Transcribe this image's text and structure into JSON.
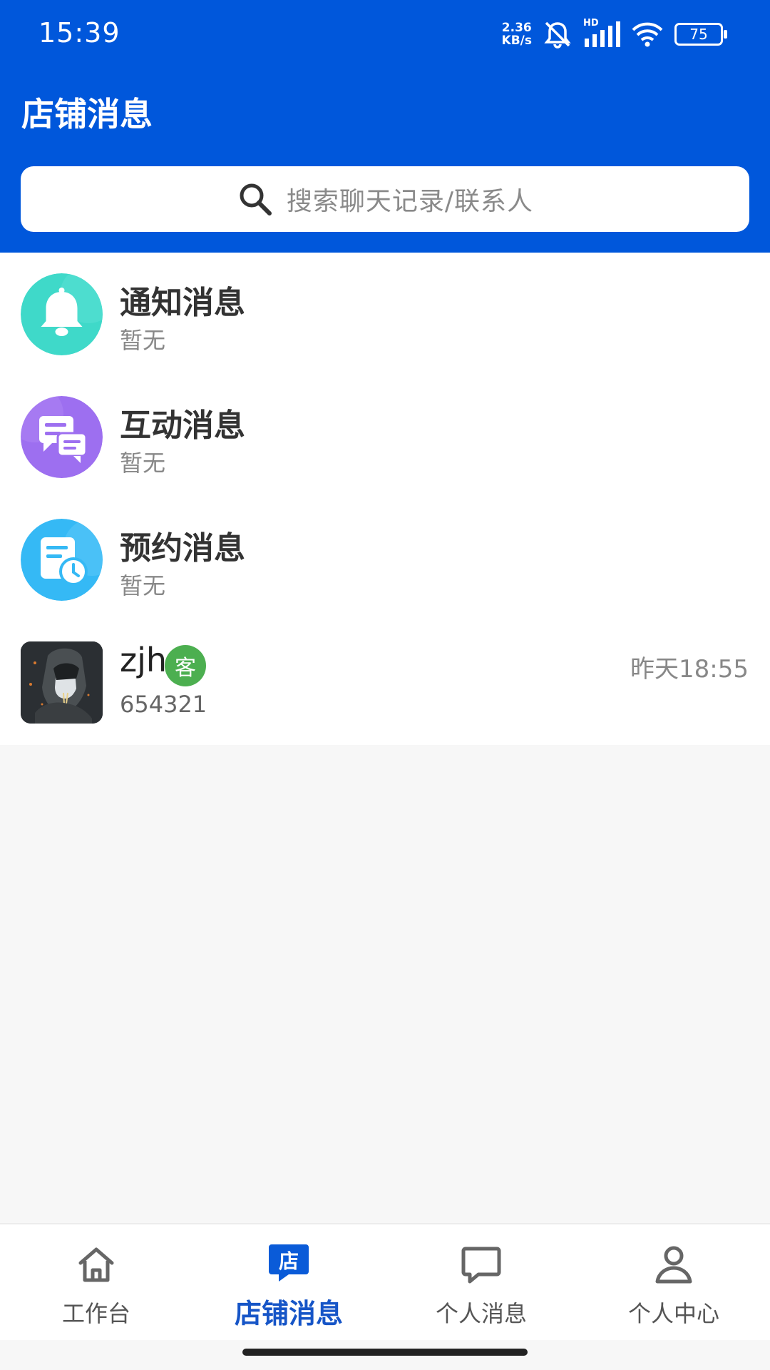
{
  "status_bar": {
    "time": "15:39",
    "network_speed_value": "2.36",
    "network_speed_unit": "KB/s",
    "signal_label": "HD",
    "battery": "75",
    "icons": [
      "mute-bell-icon",
      "signal-icon",
      "wifi-icon",
      "battery-icon"
    ]
  },
  "header": {
    "title": "店铺消息",
    "search_placeholder": "搜索聊天记录/联系人"
  },
  "messages": [
    {
      "title": "通知消息",
      "subtitle": "暂无",
      "icon": "bell-icon",
      "color": "#3fd9c9"
    },
    {
      "title": "互动消息",
      "subtitle": "暂无",
      "icon": "chat-icon",
      "color": "#9d6ff0"
    },
    {
      "title": "预约消息",
      "subtitle": "暂无",
      "icon": "appointment-clock-icon",
      "color": "#35b9f5"
    }
  ],
  "chat": {
    "name": "zjh",
    "badge": "客",
    "preview": "654321",
    "time": "昨天18:55"
  },
  "bottom_nav": [
    {
      "label": "工作台",
      "icon": "home-icon",
      "active": false
    },
    {
      "label": "店铺消息",
      "icon": "store-message-icon",
      "active": true
    },
    {
      "label": "个人消息",
      "icon": "chat-bubble-icon",
      "active": false
    },
    {
      "label": "个人中心",
      "icon": "user-icon",
      "active": false
    }
  ],
  "colors": {
    "primary": "#0057db",
    "active_nav": "#1655c7",
    "badge": "#4caf50"
  }
}
